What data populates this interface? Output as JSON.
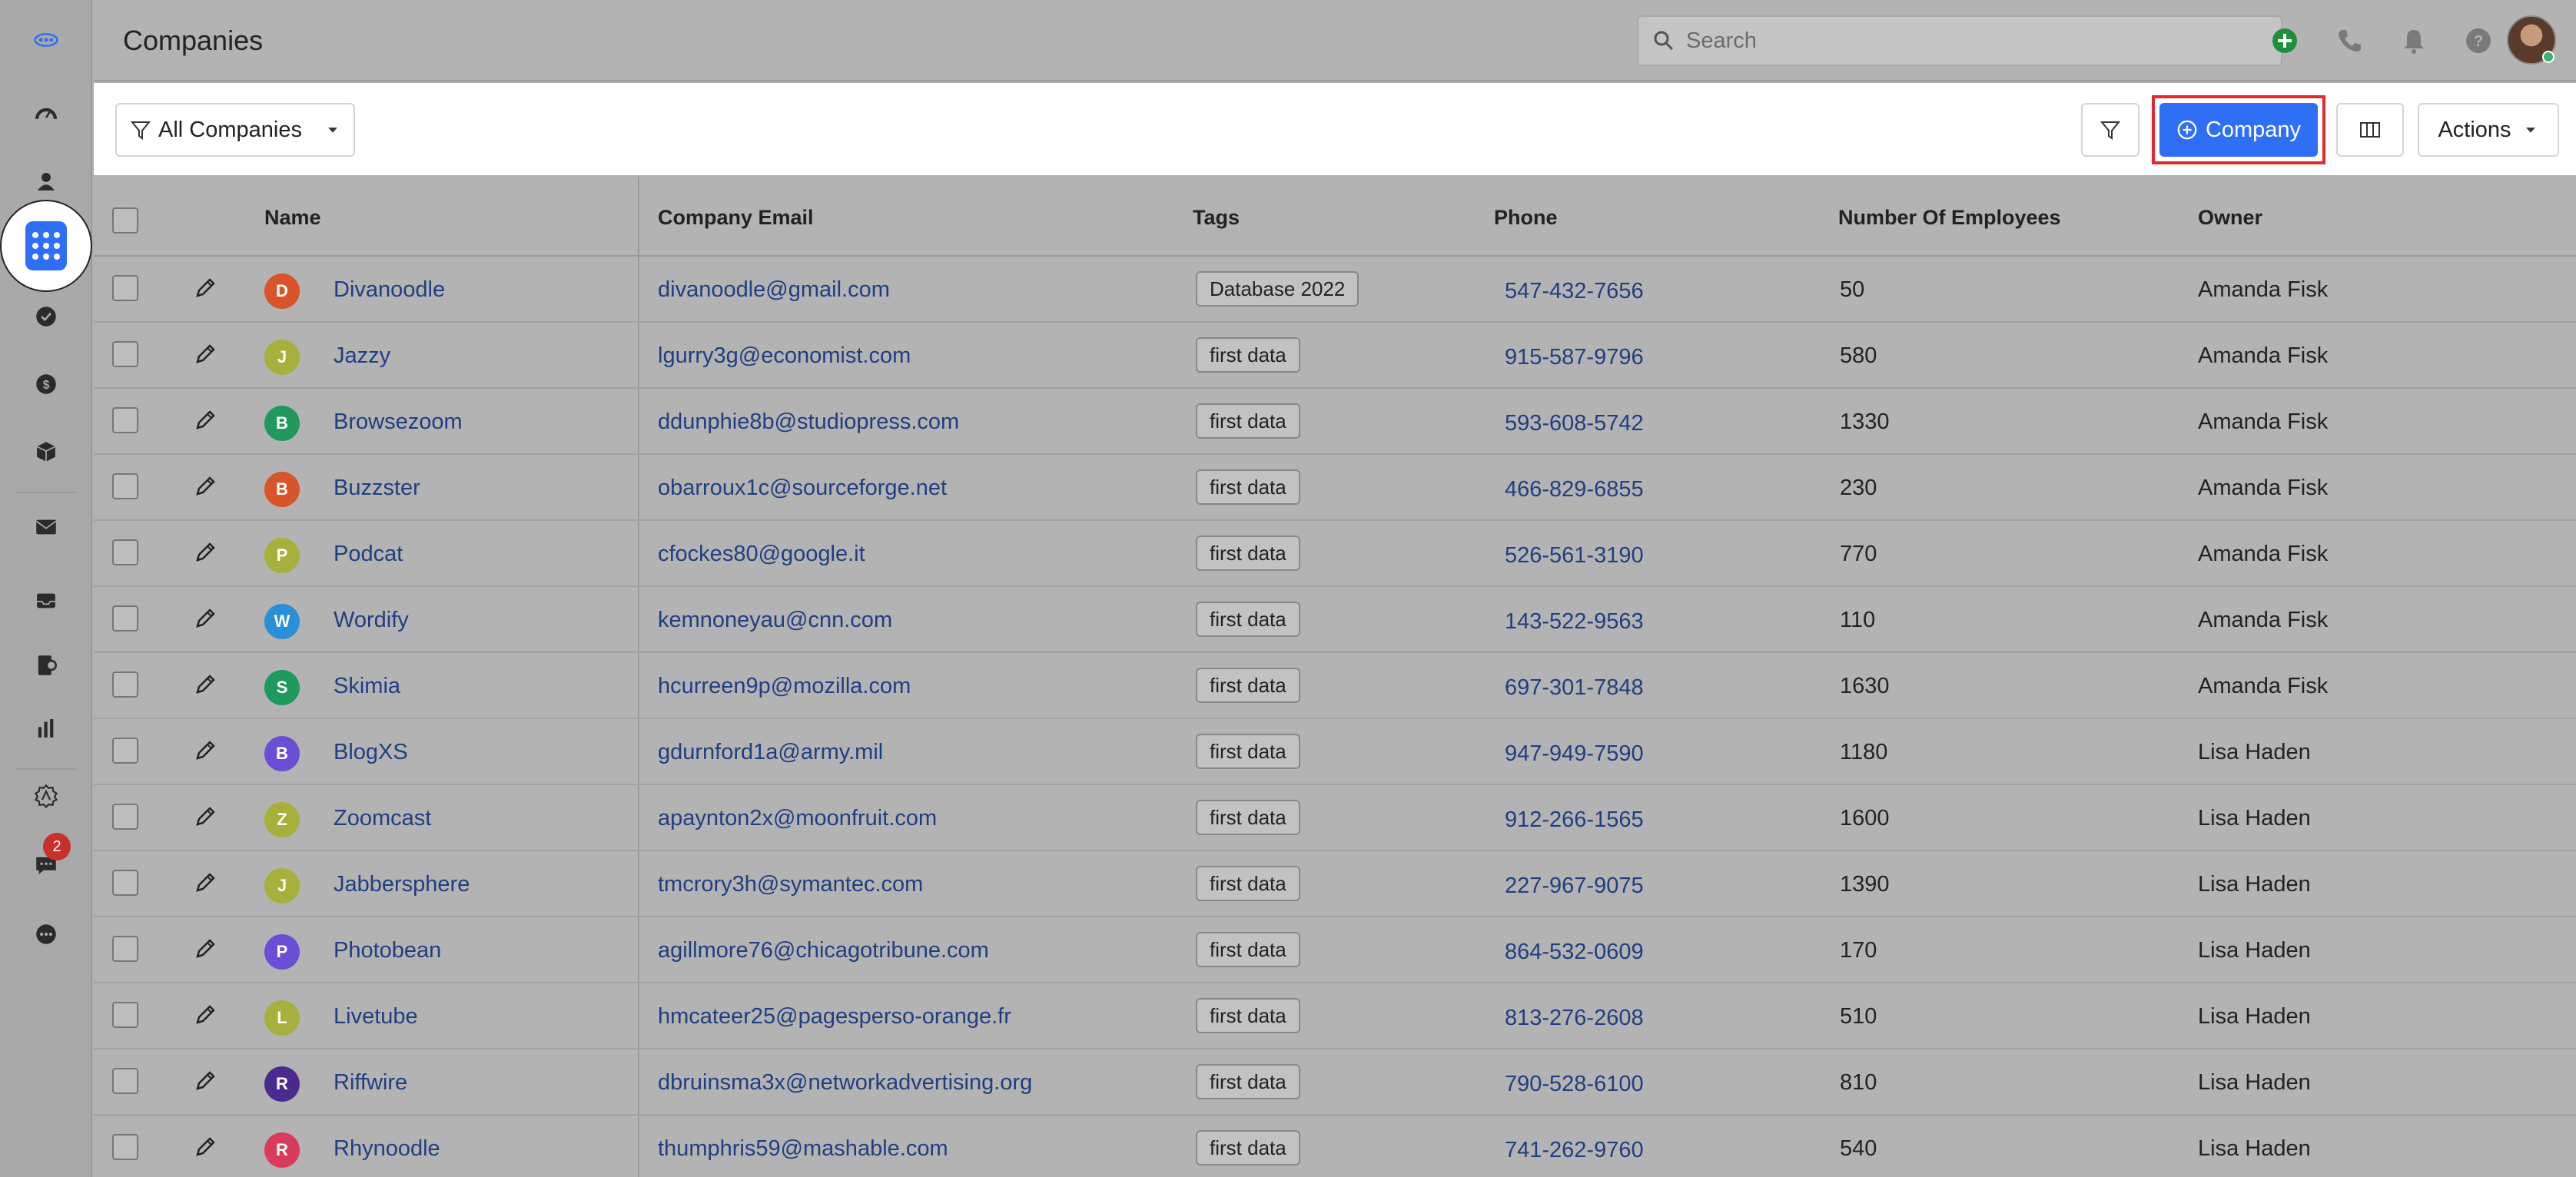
{
  "app": {
    "title": "Companies",
    "search_placeholder": "Search",
    "notification_badge": "2"
  },
  "sidebar": {
    "icons": [
      "logo-icon",
      "dashboard-icon",
      "contacts-icon",
      "companies-icon",
      "tasks-icon",
      "deals-icon",
      "products-icon",
      "email-icon",
      "inbox-icon",
      "billing-icon",
      "reports-icon",
      "automation-icon",
      "chat-icon",
      "more-icon"
    ],
    "active": "companies-icon"
  },
  "toolbar": {
    "view_label": "All Companies",
    "add_label": "Company",
    "actions_label": "Actions"
  },
  "table": {
    "headers": {
      "name": "Name",
      "email": "Company Email",
      "tags": "Tags",
      "phone": "Phone",
      "employees": "Number Of Employees",
      "owner": "Owner"
    },
    "rows": [
      {
        "initial": "D",
        "color": "#d9542b",
        "name": "Divanoodle",
        "email": "divanoodle@gmail.com",
        "tag": "Database 2022",
        "phone": "547-432-7656",
        "employees": "50",
        "owner": "Amanda Fisk"
      },
      {
        "initial": "J",
        "color": "#a7b03a",
        "name": "Jazzy",
        "email": "lgurry3g@economist.com",
        "tag": "first data",
        "phone": "915-587-9796",
        "employees": "580",
        "owner": "Amanda Fisk"
      },
      {
        "initial": "B",
        "color": "#1f9a5c",
        "name": "Browsezoom",
        "email": "ddunphie8b@studiopress.com",
        "tag": "first data",
        "phone": "593-608-5742",
        "employees": "1330",
        "owner": "Amanda Fisk"
      },
      {
        "initial": "B",
        "color": "#d9542b",
        "name": "Buzzster",
        "email": "obarroux1c@sourceforge.net",
        "tag": "first data",
        "phone": "466-829-6855",
        "employees": "230",
        "owner": "Amanda Fisk"
      },
      {
        "initial": "P",
        "color": "#a7b03a",
        "name": "Podcat",
        "email": "cfockes80@google.it",
        "tag": "first data",
        "phone": "526-561-3190",
        "employees": "770",
        "owner": "Amanda Fisk"
      },
      {
        "initial": "W",
        "color": "#2a8fd6",
        "name": "Wordify",
        "email": "kemnoneyau@cnn.com",
        "tag": "first data",
        "phone": "143-522-9563",
        "employees": "110",
        "owner": "Amanda Fisk"
      },
      {
        "initial": "S",
        "color": "#1f9a5c",
        "name": "Skimia",
        "email": "hcurreen9p@mozilla.com",
        "tag": "first data",
        "phone": "697-301-7848",
        "employees": "1630",
        "owner": "Amanda Fisk"
      },
      {
        "initial": "B",
        "color": "#6a4fd6",
        "name": "BlogXS",
        "email": "gdurnford1a@army.mil",
        "tag": "first data",
        "phone": "947-949-7590",
        "employees": "1180",
        "owner": "Lisa Haden"
      },
      {
        "initial": "Z",
        "color": "#a7b03a",
        "name": "Zoomcast",
        "email": "apaynton2x@moonfruit.com",
        "tag": "first data",
        "phone": "912-266-1565",
        "employees": "1600",
        "owner": "Lisa Haden"
      },
      {
        "initial": "J",
        "color": "#a7b03a",
        "name": "Jabbersphere",
        "email": "tmcrory3h@symantec.com",
        "tag": "first data",
        "phone": "227-967-9075",
        "employees": "1390",
        "owner": "Lisa Haden"
      },
      {
        "initial": "P",
        "color": "#6a4fd6",
        "name": "Photobean",
        "email": "agillmore76@chicagotribune.com",
        "tag": "first data",
        "phone": "864-532-0609",
        "employees": "170",
        "owner": "Lisa Haden"
      },
      {
        "initial": "L",
        "color": "#a7b03a",
        "name": "Livetube",
        "email": "hmcateer25@pagesperso-orange.fr",
        "tag": "first data",
        "phone": "813-276-2608",
        "employees": "510",
        "owner": "Lisa Haden"
      },
      {
        "initial": "R",
        "color": "#4b2a8f",
        "name": "Riffwire",
        "email": "dbruinsma3x@networkadvertising.org",
        "tag": "first data",
        "phone": "790-528-6100",
        "employees": "810",
        "owner": "Lisa Haden"
      },
      {
        "initial": "R",
        "color": "#d93b5a",
        "name": "Rhynoodle",
        "email": "thumphris59@mashable.com",
        "tag": "first data",
        "phone": "741-262-9760",
        "employees": "540",
        "owner": "Lisa Haden"
      }
    ]
  }
}
